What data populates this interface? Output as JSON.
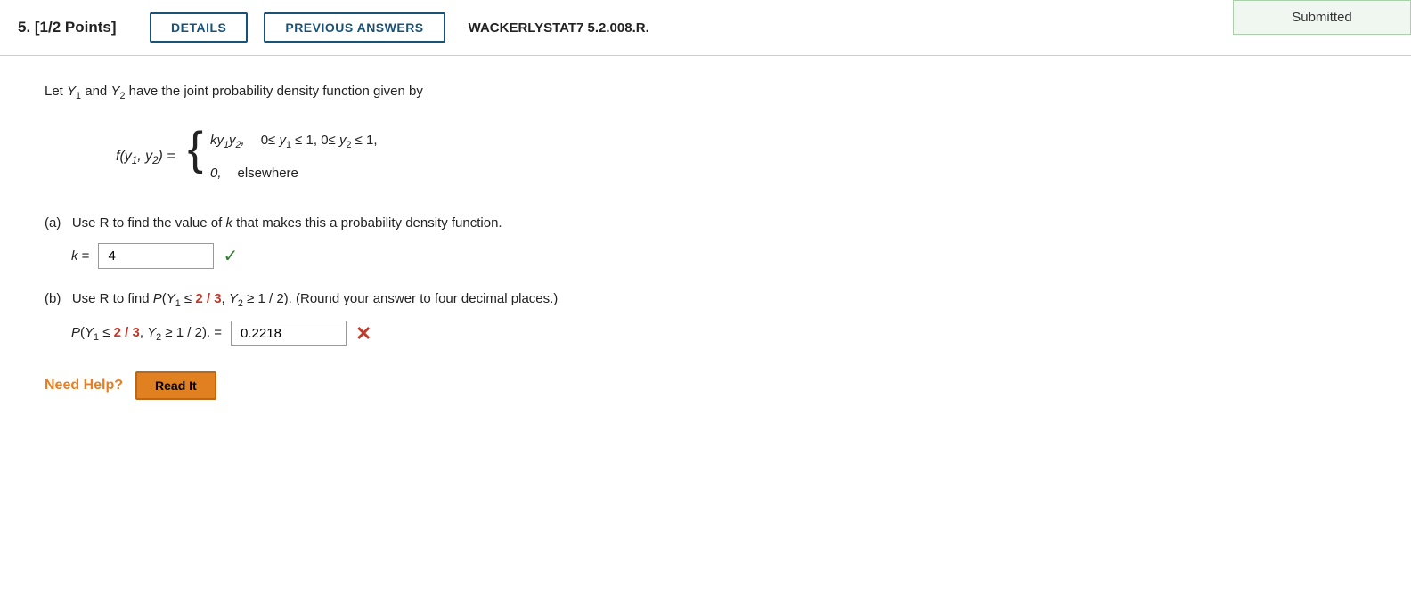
{
  "header": {
    "question_number": "5.  [1/2 Points]",
    "details_btn": "DETAILS",
    "prev_answers_btn": "PREVIOUS ANSWERS",
    "wackerly_ref": "WACKERLYSTAT7 5.2.008.R.",
    "submitted": "Submitted"
  },
  "content": {
    "intro": "Let Y₁ and Y₂ have the joint probability density function given by",
    "formula": {
      "lhs": "f(y₁, y₂) =",
      "case1_expr": "ky₁y₂,",
      "case1_cond": "0≤ y₁ ≤ 1, 0≤ y₂ ≤ 1,",
      "case2_expr": "0,",
      "case2_cond": "elsewhere"
    },
    "part_a": {
      "label": "(a)   Use R to find the value of k that makes this a probability density function.",
      "k_label": "k =",
      "k_value": "4",
      "status": "correct"
    },
    "part_b": {
      "label_prefix": "(b)   Use R to find P(Y",
      "label_suffix": "). (Round your answer to four decimal places.)",
      "answer_label": "P(Y₁ ≤ 2 / 3, Y₂ ≥ 1 / 2). =",
      "answer_value": "0.2218",
      "status": "incorrect"
    },
    "need_help": {
      "label": "Need Help?",
      "read_it_btn": "Read It"
    }
  }
}
